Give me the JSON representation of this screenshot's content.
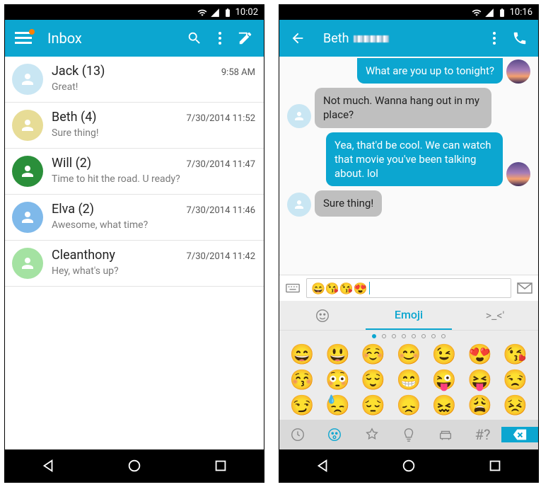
{
  "left": {
    "status_time": "10:02",
    "title": "Inbox",
    "conversations": [
      {
        "name": "Jack (13)",
        "time": "9:58 AM",
        "preview": "Great!",
        "avatar_color": "#c9e6f3"
      },
      {
        "name": "Beth (4)",
        "time": "7/30/2014 11:52",
        "preview": "Sure thing!",
        "avatar_color": "#e7dc96"
      },
      {
        "name": "Will (2)",
        "time": "7/30/2014 11:47",
        "preview": "Time to hit the road. U ready?",
        "avatar_color": "#2a8f3a"
      },
      {
        "name": "Elva (2)",
        "time": "7/30/2014 11:46",
        "preview": "Awesome, what time?",
        "avatar_color": "#7fb9ea"
      },
      {
        "name": "Cleanthony",
        "time": "7/30/2014 11:42",
        "preview": "Hey, what's up?",
        "avatar_color": "#a4e2a2"
      }
    ]
  },
  "right": {
    "status_time": "10:16",
    "contact": "Beth",
    "messages": [
      {
        "dir": "out",
        "text": "What are you up to tonight?",
        "cut": true
      },
      {
        "dir": "in",
        "text": "Not much. Wanna hang out in my place?"
      },
      {
        "dir": "out",
        "text": "Yea, that'd be cool. We can watch that movie you've been talking about. lol"
      },
      {
        "dir": "in",
        "text": "Sure thing!"
      }
    ],
    "compose_value": "😄😘😘😍",
    "keyboard": {
      "tabs": {
        "emoji": "Emoji",
        "kaomoji": ">_<'"
      },
      "emojis": [
        "😄",
        "😃",
        "☺️",
        "😊",
        "😉",
        "😍",
        "😘",
        "😚",
        "😳",
        "😌",
        "😁",
        "😜",
        "😝",
        "😒",
        "😏",
        "😓",
        "😔",
        "😞",
        "😖",
        "😩",
        "😣"
      ],
      "bottom_hash": "#?"
    }
  }
}
